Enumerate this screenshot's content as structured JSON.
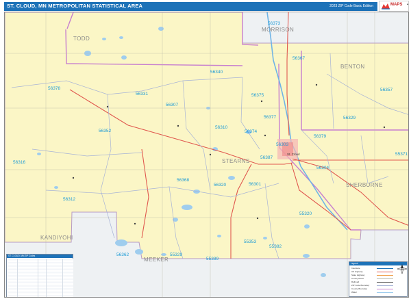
{
  "header": {
    "title": "ST. CLOUD, MN METROPOLITAN STATISTICAL AREA",
    "edition": "2023 ZIP Code Basic Edition",
    "brand": "MAPS"
  },
  "counties": [
    {
      "id": "todd",
      "label": "TODD"
    },
    {
      "id": "morrison",
      "label": "MORRISON"
    },
    {
      "id": "benton",
      "label": "BENTON"
    },
    {
      "id": "stearns",
      "label": "STEARNS"
    },
    {
      "id": "sherburne",
      "label": "SHERBURNE"
    },
    {
      "id": "kandiyohi",
      "label": "KANDIYOHI"
    },
    {
      "id": "meeker",
      "label": "MEEKER"
    }
  ],
  "zips": [
    {
      "code": "56373"
    },
    {
      "code": "56367"
    },
    {
      "code": "56340"
    },
    {
      "code": "56378"
    },
    {
      "code": "56331"
    },
    {
      "code": "56375"
    },
    {
      "code": "56357"
    },
    {
      "code": "56307"
    },
    {
      "code": "56377"
    },
    {
      "code": "56329"
    },
    {
      "code": "56310"
    },
    {
      "code": "56374"
    },
    {
      "code": "56352"
    },
    {
      "code": "56379"
    },
    {
      "code": "56303"
    },
    {
      "code": "56387"
    },
    {
      "code": "56316"
    },
    {
      "code": "56304"
    },
    {
      "code": "55371"
    },
    {
      "code": "56368"
    },
    {
      "code": "56320"
    },
    {
      "code": "56301"
    },
    {
      "code": "56312"
    },
    {
      "code": "55320"
    },
    {
      "code": "55353"
    },
    {
      "code": "55382"
    },
    {
      "code": "56362"
    },
    {
      "code": "55329"
    },
    {
      "code": "55389"
    }
  ],
  "cities": [
    {
      "label": "St. Cloud"
    }
  ],
  "zip_table": {
    "title": "ST. CLOUD, MN ZIP Codes"
  },
  "legend": {
    "title": "Legend",
    "items": [
      "Interstate",
      "US Highway",
      "State Highway",
      "County Road",
      "Railroad",
      "ZIP Code Boundary",
      "County Boundary",
      "Water"
    ]
  },
  "colors": {
    "msa_fill": "#fbf6c6",
    "outside_fill": "#eef1f3",
    "water": "#9fcdee",
    "zip_label": "#1a9ad6",
    "county_boundary": "#c77fcf",
    "highway": "#e0584f",
    "title_bar": "#1d72b8"
  }
}
